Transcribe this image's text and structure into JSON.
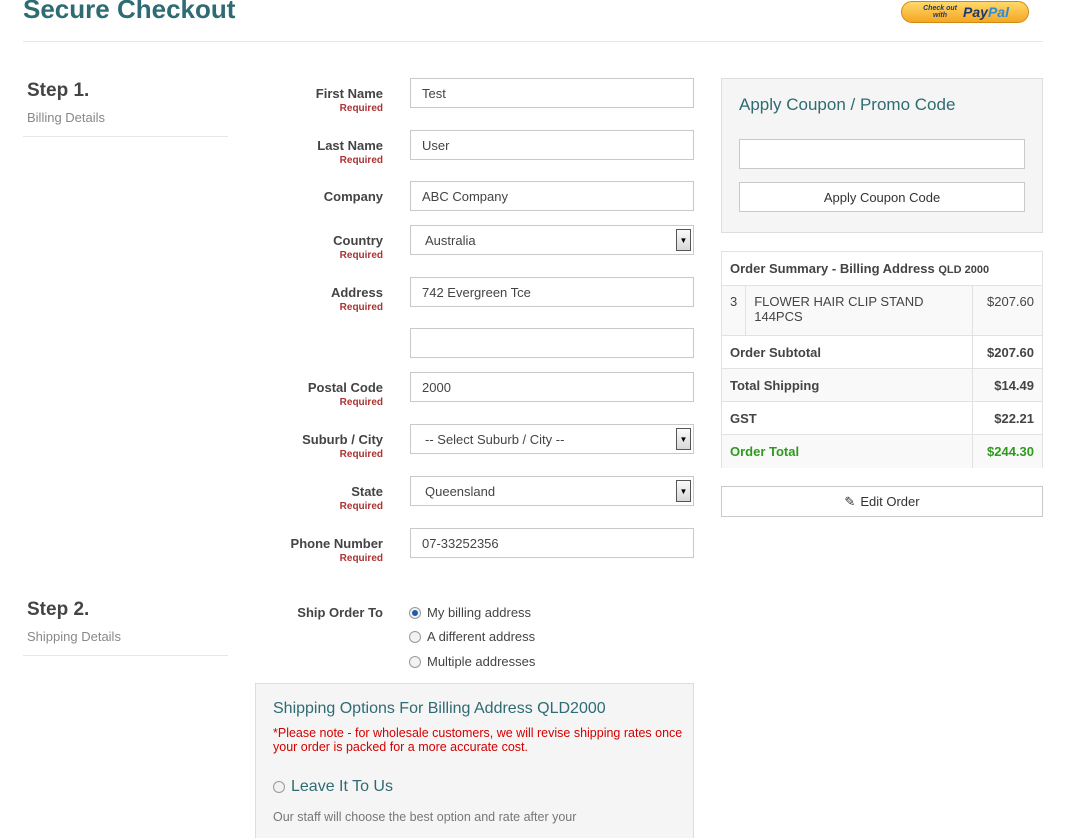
{
  "header": {
    "title": "Secure Checkout",
    "paypal": {
      "small": "Check out with",
      "brand_a": "Pay",
      "brand_b": "Pal"
    }
  },
  "step1": {
    "title": "Step 1.",
    "subtitle": "Billing Details"
  },
  "step2": {
    "title": "Step 2.",
    "subtitle": "Shipping Details"
  },
  "required_text": "Required",
  "billing": {
    "first_name": {
      "label": "First Name",
      "value": "Test"
    },
    "last_name": {
      "label": "Last Name",
      "value": "User"
    },
    "company": {
      "label": "Company",
      "value": "ABC Company"
    },
    "country": {
      "label": "Country",
      "value": "Australia"
    },
    "address": {
      "label": "Address",
      "value": "742 Evergreen Tce",
      "value2": ""
    },
    "postal_code": {
      "label": "Postal Code",
      "value": "2000"
    },
    "suburb": {
      "label": "Suburb / City",
      "value": "-- Select Suburb / City --"
    },
    "state": {
      "label": "State",
      "value": "Queensland"
    },
    "phone": {
      "label": "Phone Number",
      "value": "07-33252356"
    }
  },
  "ship_to": {
    "label": "Ship Order To",
    "options": [
      "My billing address",
      "A different address",
      "Multiple addresses"
    ],
    "selected": 0
  },
  "shipping_options": {
    "title": "Shipping Options For Billing Address QLD2000",
    "note": "*Please note - for wholesale customers, we will revise shipping rates once your order is packed for a more accurate cost.",
    "option_label": "Leave It To Us",
    "option_desc": "Our staff will choose the best option and rate after your"
  },
  "coupon": {
    "title": "Apply Coupon / Promo Code",
    "input_value": "",
    "button": "Apply Coupon Code"
  },
  "order_summary": {
    "heading": "Order Summary - Billing Address",
    "heading_code": "QLD 2000",
    "item": {
      "qty": "3",
      "name": "FLOWER HAIR CLIP STAND 144PCS",
      "price": "$207.60"
    },
    "subtotal": {
      "label": "Order Subtotal",
      "value": "$207.60"
    },
    "shipping": {
      "label": "Total Shipping",
      "value": "$14.49"
    },
    "gst": {
      "label": "GST",
      "value": "$22.21"
    },
    "total": {
      "label": "Order Total",
      "value": "$244.30"
    },
    "accent_total": "#2e9a1e"
  },
  "edit_order": {
    "label": "Edit Order",
    "icon": "pencil-icon"
  },
  "colors": {
    "heading": "#2e6b73",
    "required": "#a33333",
    "note": "#d40000"
  }
}
